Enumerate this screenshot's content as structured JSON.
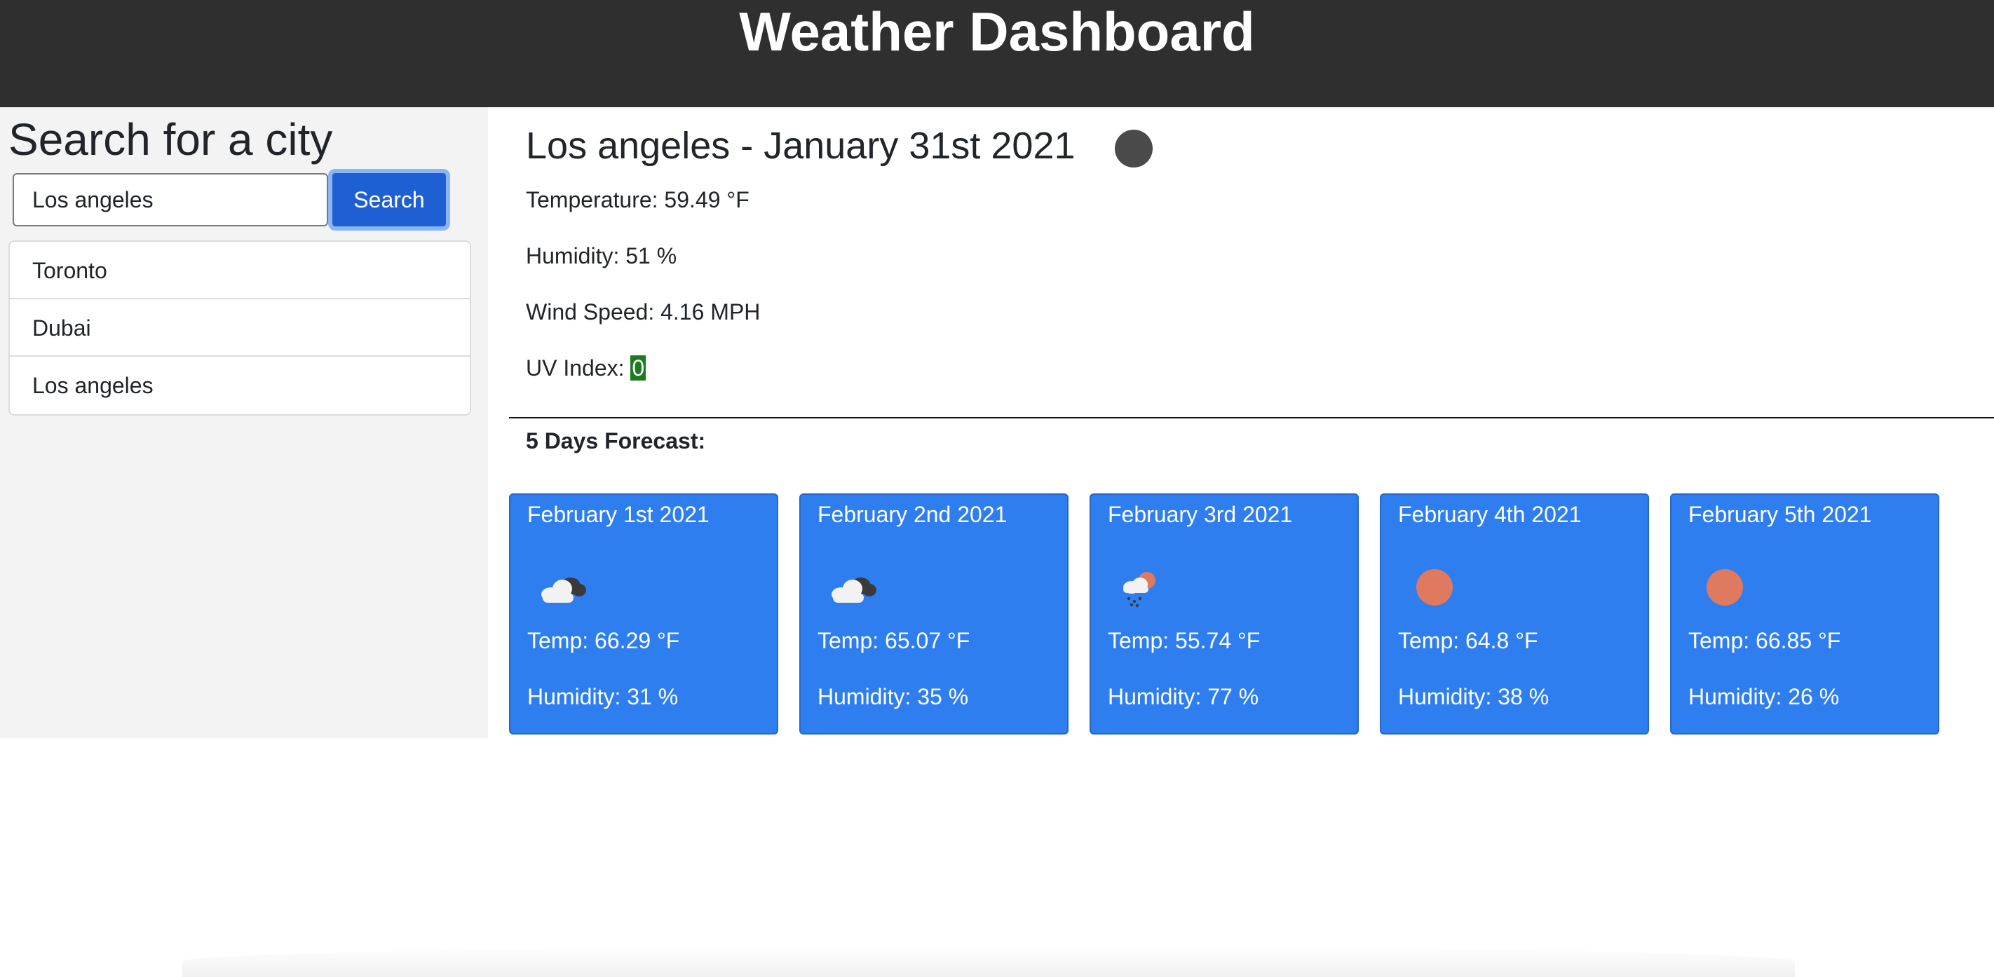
{
  "header": {
    "title": "Weather Dashboard"
  },
  "sidebar": {
    "heading": "Search for a city",
    "search": {
      "value": "Los angeles",
      "placeholder": ""
    },
    "search_button_label": "Search",
    "history": [
      {
        "label": "Toronto"
      },
      {
        "label": "Dubai"
      },
      {
        "label": "Los angeles"
      }
    ]
  },
  "current": {
    "title": "Los angeles - January 31st 2021",
    "icon": "night-clear-icon",
    "temperature": "Temperature: 59.49 °F",
    "humidity": "Humidity: 51 %",
    "wind": "Wind Speed: 4.16 MPH",
    "uv_label": "UV Index: ",
    "uv_value": "0",
    "uv_color": "#1e7a1e"
  },
  "forecast": {
    "heading": "5 Days Forecast:",
    "days": [
      {
        "date": "February 1st 2021",
        "icon": "cloudy-icon",
        "temp": "Temp: 66.29 °F",
        "humidity": "Humidity: 31 %"
      },
      {
        "date": "February 2nd 2021",
        "icon": "cloudy-icon",
        "temp": "Temp: 65.07 °F",
        "humidity": "Humidity: 35 %"
      },
      {
        "date": "February 3rd 2021",
        "icon": "snow-sun-icon",
        "temp": "Temp: 55.74 °F",
        "humidity": "Humidity: 77 %"
      },
      {
        "date": "February 4th 2021",
        "icon": "sun-icon",
        "temp": "Temp: 64.8 °F",
        "humidity": "Humidity: 38 %"
      },
      {
        "date": "February 5th 2021",
        "icon": "sun-icon",
        "temp": "Temp: 66.85 °F",
        "humidity": "Humidity: 26 %"
      }
    ]
  },
  "colors": {
    "header_bg": "#2f2f2f",
    "card_bg": "#2f7ef0",
    "button_bg": "#1f5fd4",
    "sun": "#e07a5f"
  }
}
